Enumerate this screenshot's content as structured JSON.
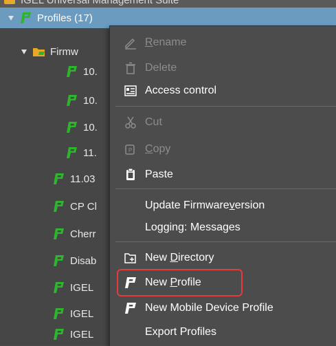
{
  "header": {
    "truncated_text": "IGEL Universal Management Suite"
  },
  "tree": {
    "root_label": "Profiles (17)",
    "folder_label": "Firmw",
    "firmware_children": [
      "10.",
      "10.",
      "10.",
      "11."
    ],
    "profiles": [
      "11.03",
      "CP Cl",
      "Cherr",
      "Disab",
      "IGEL",
      "IGEL",
      "IGEL"
    ]
  },
  "menu": {
    "rename": {
      "pre": "",
      "mn": "R",
      "post": "ename"
    },
    "delete": "Delete",
    "access_control": "Access control",
    "cut": "Cut",
    "copy": {
      "pre": "",
      "mn": "C",
      "post": "opy"
    },
    "paste": "Paste",
    "update_firmware": {
      "pre": "Update Firmware",
      "mn": "v",
      "post": "ersion"
    },
    "logging": "Logging: Messages",
    "new_directory": {
      "pre": "New ",
      "mn": "D",
      "post": "irectory"
    },
    "new_profile": {
      "pre": "New ",
      "mn": "P",
      "post": "rofile"
    },
    "new_mobile_profile": "New Mobile Device Profile",
    "export_profiles": "Export Profiles"
  },
  "colors": {
    "selection": "#6b9bbf",
    "profile_icon": "#2db52d",
    "highlight": "#e53b3b",
    "folder": "#e8a92a"
  }
}
